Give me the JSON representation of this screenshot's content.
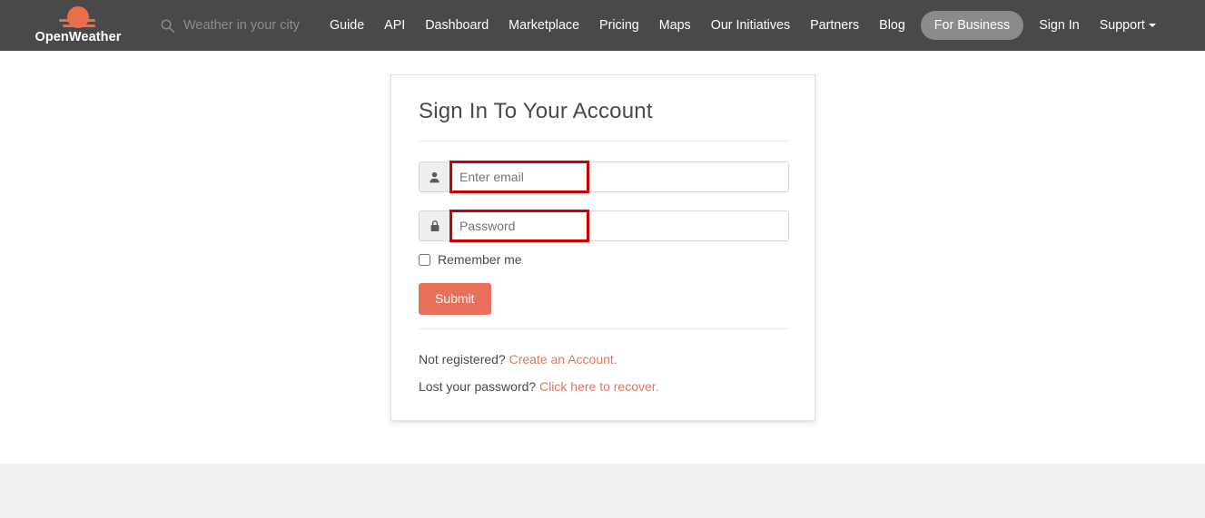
{
  "navbar": {
    "brand": {
      "name": "OpenWeather",
      "logo_icon": "sun-cloud-icon",
      "accent_color": "#eb6e4b"
    },
    "search": {
      "icon": "search-icon",
      "placeholder": "Weather in your city",
      "value": ""
    },
    "background_color": "#494949",
    "links": [
      {
        "label": "Guide",
        "active": false
      },
      {
        "label": "API",
        "active": false
      },
      {
        "label": "Dashboard",
        "active": false
      },
      {
        "label": "Marketplace",
        "active": false
      },
      {
        "label": "Pricing",
        "active": false
      },
      {
        "label": "Maps",
        "active": false
      },
      {
        "label": "Our Initiatives",
        "active": false
      },
      {
        "label": "Partners",
        "active": false
      },
      {
        "label": "Blog",
        "active": false
      },
      {
        "label": "For Business",
        "active": true
      },
      {
        "label": "Sign In",
        "active": false
      },
      {
        "label": "Support",
        "active": false,
        "has_caret": true
      }
    ]
  },
  "card": {
    "title": "Sign In To Your Account",
    "email_field": {
      "icon": "user-icon",
      "placeholder": "Enter email",
      "value": "",
      "annotated": true,
      "annotation_color": "#cc0000"
    },
    "password_field": {
      "icon": "lock-icon",
      "placeholder": "Password",
      "value": "",
      "annotated": true,
      "annotation_color": "#cc0000"
    },
    "remember_me": {
      "label": "Remember me",
      "checked": false
    },
    "submit_button": {
      "label": "Submit",
      "color": "#e8705a"
    },
    "footer_links": [
      {
        "text": "Not registered?",
        "link_text": "Create an Account.",
        "link_color": "#e2765c"
      },
      {
        "text": "Lost your password?",
        "link_text": "Click here to recover.",
        "link_color": "#e2765c"
      }
    ]
  }
}
